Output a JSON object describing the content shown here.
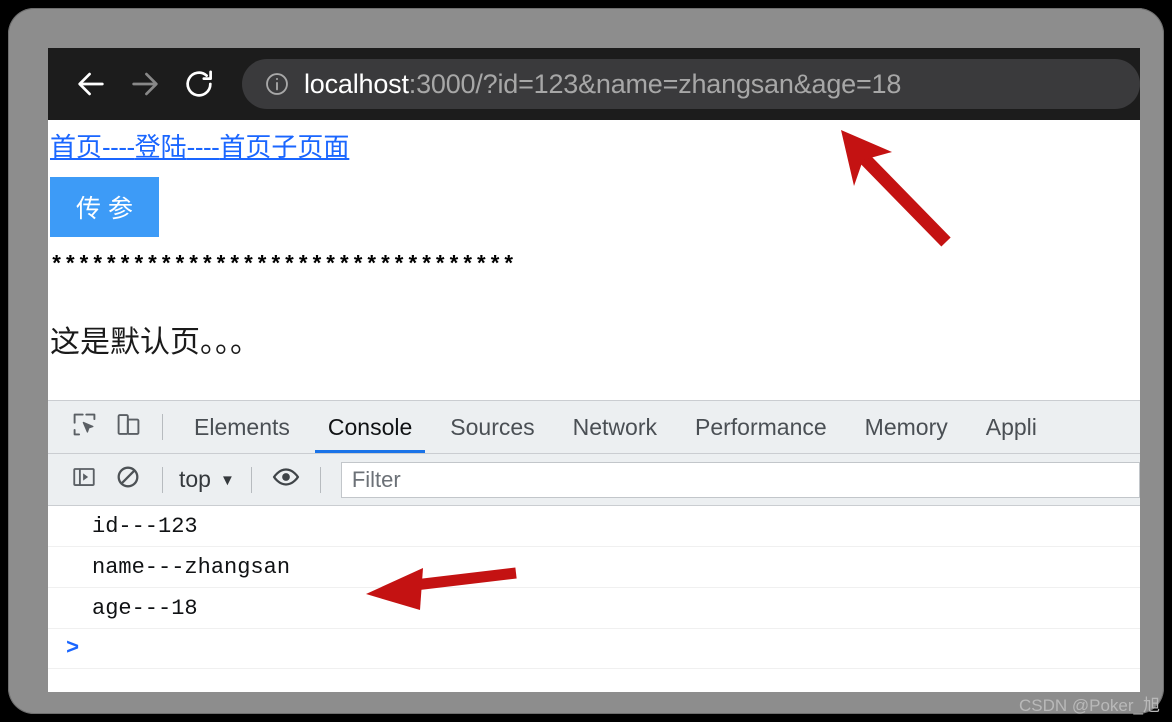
{
  "browser": {
    "back_icon": "arrow-left-icon",
    "forward_icon": "arrow-right-icon",
    "reload_icon": "reload-icon",
    "info_icon": "info-circle-icon",
    "url_host": "localhost",
    "url_rest": ":3000/?id=123&name=zhangsan&age=18",
    "url_full": "localhost:3000/?id=123&name=zhangsan&age=18"
  },
  "page": {
    "links": [
      {
        "label": "首页"
      },
      {
        "label": "登陆"
      },
      {
        "label": "首页子页面"
      }
    ],
    "link_separator": "----",
    "button_label": "传 参",
    "stars": "**********************************",
    "default_text": "这是默认页。。。"
  },
  "devtools": {
    "inspect_icon": "inspect-element-icon",
    "device_toolbar_icon": "device-toggle-icon",
    "tabs": [
      {
        "label": "Elements",
        "active": false
      },
      {
        "label": "Console",
        "active": true
      },
      {
        "label": "Sources",
        "active": false
      },
      {
        "label": "Network",
        "active": false
      },
      {
        "label": "Performance",
        "active": false
      },
      {
        "label": "Memory",
        "active": false
      },
      {
        "label": "Appli",
        "active": false
      }
    ],
    "console_toolbar": {
      "sidebar_icon": "console-sidebar-icon",
      "clear_icon": "clear-console-icon",
      "context_label": "top",
      "context_caret": "▼",
      "eye_icon": "live-expression-eye-icon",
      "filter_placeholder": "Filter",
      "filter_value": ""
    },
    "console_rows": [
      {
        "text": "id---123"
      },
      {
        "text": "name---zhangsan"
      },
      {
        "text": "age---18"
      }
    ],
    "prompt_symbol": ">"
  },
  "annotations": {
    "arrow_1_name": "red-arrow-to-url-bar",
    "arrow_2_name": "red-arrow-to-console-line"
  },
  "watermark": {
    "text": "CSDN @Poker_旭"
  },
  "colors": {
    "accent_blue": "#1a73e8",
    "link_blue": "#1a66ff",
    "button_blue": "#3d9bf7",
    "annotation_red": "#c41212",
    "toolbar_dark": "#1c1c1c",
    "url_pill": "#3a3a3c",
    "devtools_chrome": "#eceff1"
  }
}
